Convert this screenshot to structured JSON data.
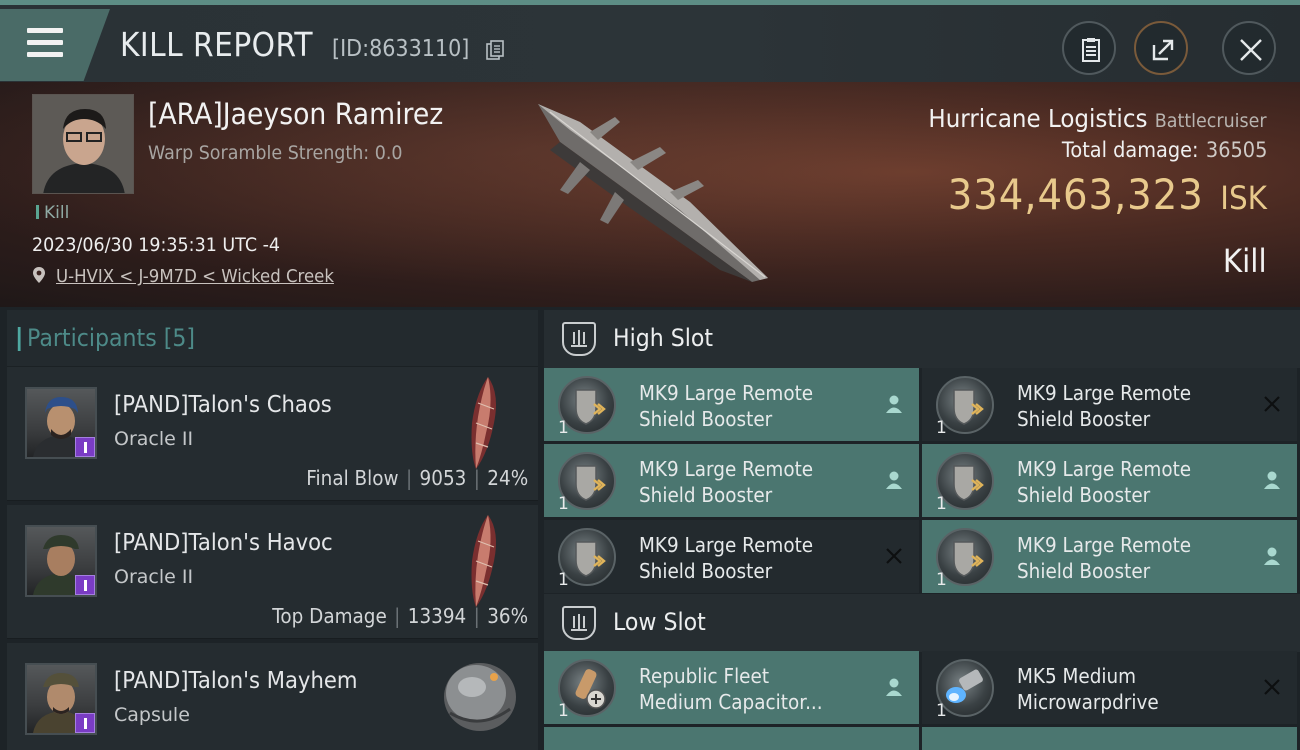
{
  "header": {
    "title": "KILL REPORT",
    "report_id": "[ID:8633110]"
  },
  "victim": {
    "name": "[ARA]Jaeyson Ramirez",
    "scramble": "Warp Soramble Strength: 0.0",
    "tag": "Kill",
    "datetime": "2023/06/30 19:35:31 UTC -4",
    "location": "U-HVIX < J-9M7D < Wicked Creek"
  },
  "ship": {
    "name": "Hurricane Logistics",
    "class": "Battlecruiser",
    "total_damage_label": "Total damage:",
    "total_damage_value": "36505",
    "isk_amount": "334,463,323",
    "isk_unit": "ISK",
    "kill_type": "Kill"
  },
  "participants": {
    "label": "Participants",
    "count": "[5]",
    "rows": [
      {
        "name": "[PAND]Talon's Chaos",
        "ship": "Oracle II",
        "role": "Final Blow",
        "damage": "9053",
        "percent": "24%"
      },
      {
        "name": "[PAND]Talon's Havoc",
        "ship": "Oracle II",
        "role": "Top Damage",
        "damage": "13394",
        "percent": "36%"
      },
      {
        "name": "[PAND]Talon's Mayhem",
        "ship": "Capsule",
        "role": "",
        "damage": "",
        "percent": ""
      }
    ]
  },
  "high_slot": {
    "label": "High Slot",
    "modules": [
      {
        "name1": "MK9 Large Remote",
        "name2": "Shield Booster",
        "qty": "1",
        "state": "dropped"
      },
      {
        "name1": "MK9 Large Remote",
        "name2": "Shield Booster",
        "qty": "1",
        "state": "destroyed"
      },
      {
        "name1": "MK9 Large Remote",
        "name2": "Shield Booster",
        "qty": "1",
        "state": "dropped"
      },
      {
        "name1": "MK9 Large Remote",
        "name2": "Shield Booster",
        "qty": "1",
        "state": "dropped"
      },
      {
        "name1": "MK9 Large Remote",
        "name2": "Shield Booster",
        "qty": "1",
        "state": "destroyed"
      },
      {
        "name1": "MK9 Large Remote",
        "name2": "Shield Booster",
        "qty": "1",
        "state": "dropped"
      }
    ]
  },
  "low_slot": {
    "label": "Low Slot",
    "modules": [
      {
        "name1": "Republic Fleet",
        "name2": "Medium Capacitor...",
        "qty": "1",
        "state": "dropped"
      },
      {
        "name1": "MK5 Medium",
        "name2": "Microwarpdrive",
        "qty": "1",
        "state": "destroyed"
      }
    ]
  },
  "colors": {
    "accent": "#4b7670",
    "isk_gold": "#e8c98c",
    "badge_purple": "#7a3cc4"
  }
}
